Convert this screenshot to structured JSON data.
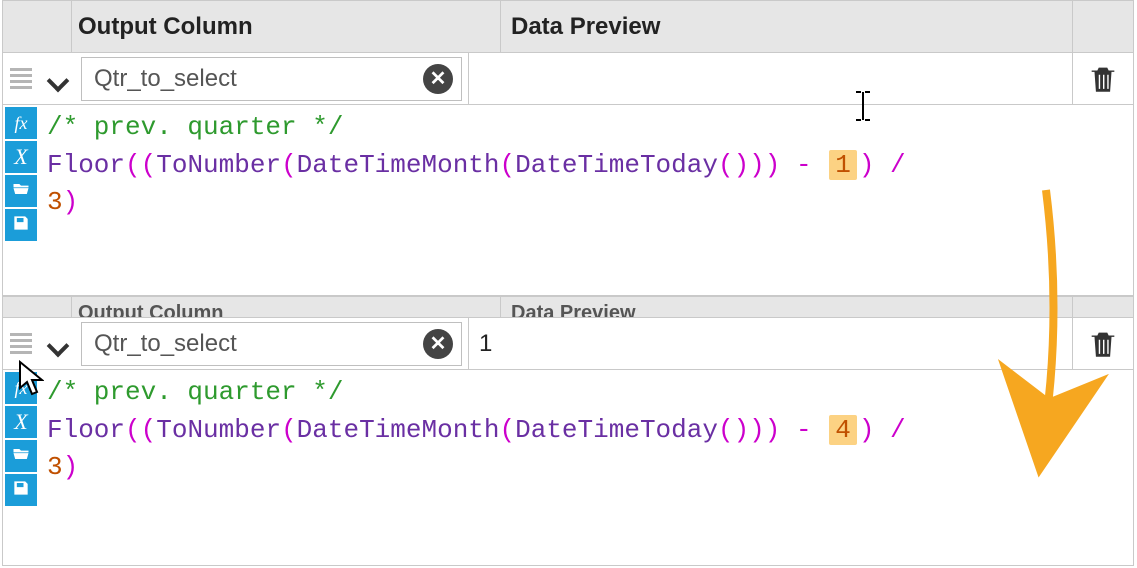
{
  "headers": {
    "output": "Output Column",
    "preview": "Data Preview"
  },
  "top": {
    "output_name": "Qtr_to_select",
    "preview_value": "",
    "code": {
      "comment": "/* prev. quarter */",
      "fn_floor": "Floor",
      "fn_tonumber": "ToNumber",
      "fn_dtmonth": "DateTimeMonth",
      "fn_dttoday": "DateTimeToday",
      "subtract_value": "1",
      "divide_value": "3"
    }
  },
  "bottom": {
    "output_name": "Qtr_to_select",
    "preview_value": "1",
    "code": {
      "comment": "/* prev. quarter */",
      "fn_floor": "Floor",
      "fn_tonumber": "ToNumber",
      "fn_dtmonth": "DateTimeMonth",
      "fn_dttoday": "DateTimeToday",
      "subtract_value": "4",
      "divide_value": "3"
    }
  },
  "icons": {
    "fx": "fx",
    "x": "X"
  }
}
